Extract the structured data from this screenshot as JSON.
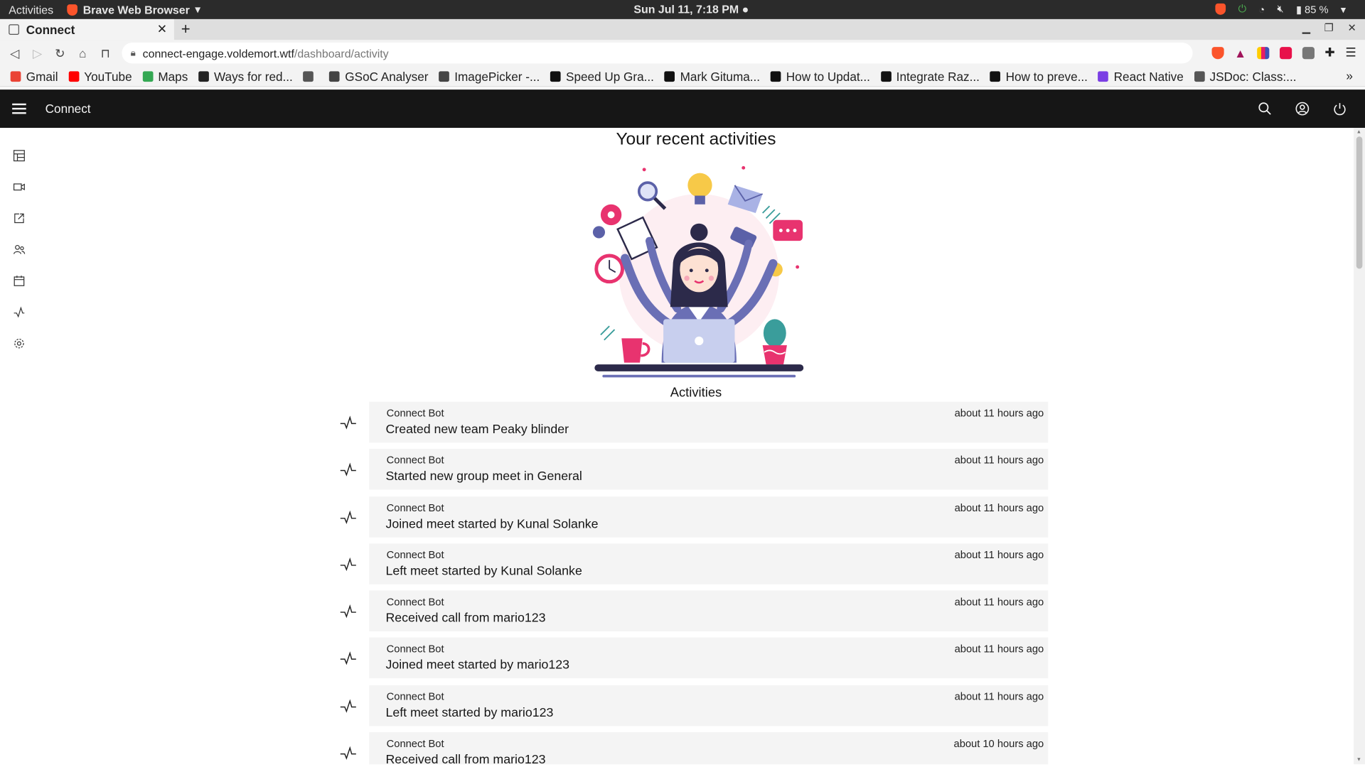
{
  "os": {
    "activities": "Activities",
    "app_name": "Brave Web Browser",
    "clock": "Sun Jul 11,  7:18 PM",
    "battery": "85 %"
  },
  "browser": {
    "tab_title": "Connect",
    "url_host": "connect-engage.voldemort.wtf",
    "url_path": "/dashboard/activity",
    "bookmarks": [
      {
        "label": "Gmail",
        "color": "#ea4335"
      },
      {
        "label": "YouTube",
        "color": "#ff0000"
      },
      {
        "label": "Maps",
        "color": "#34a853"
      },
      {
        "label": "Ways for red...",
        "color": "#222222"
      },
      {
        "label": "",
        "color": "#555555"
      },
      {
        "label": "GSoC Analyser",
        "color": "#444444"
      },
      {
        "label": "ImagePicker -...",
        "color": "#444444"
      },
      {
        "label": "Speed Up Gra...",
        "color": "#111111"
      },
      {
        "label": "Mark Gituma...",
        "color": "#111111"
      },
      {
        "label": "How to Updat...",
        "color": "#111111"
      },
      {
        "label": "Integrate Raz...",
        "color": "#111111"
      },
      {
        "label": "How to preve...",
        "color": "#111111"
      },
      {
        "label": "React Native",
        "color": "#7b3fe4"
      },
      {
        "label": "JSDoc: Class:...",
        "color": "#555555"
      }
    ]
  },
  "app": {
    "title": "Connect",
    "page_heading": "Your recent activities",
    "activities_heading": "Activities",
    "activities": [
      {
        "author": "Connect Bot",
        "message": "Created new team Peaky blinder",
        "time": "about 11 hours ago"
      },
      {
        "author": "Connect Bot",
        "message": "Started new group meet in General",
        "time": "about 11 hours ago"
      },
      {
        "author": "Connect Bot",
        "message": "Joined meet started by Kunal Solanke",
        "time": "about 11 hours ago"
      },
      {
        "author": "Connect Bot",
        "message": "Left meet started by Kunal Solanke",
        "time": "about 11 hours ago"
      },
      {
        "author": "Connect Bot",
        "message": "Received call from mario123",
        "time": "about 11 hours ago"
      },
      {
        "author": "Connect Bot",
        "message": "Joined meet started by mario123",
        "time": "about 11 hours ago"
      },
      {
        "author": "Connect Bot",
        "message": "Left meet started by mario123",
        "time": "about 11 hours ago"
      },
      {
        "author": "Connect Bot",
        "message": "Received call from mario123",
        "time": "about 10 hours ago"
      }
    ]
  },
  "colors": {
    "header_bg": "#161616",
    "card_bg": "#f4f4f4",
    "accent_pink": "#e8336f",
    "accent_purple": "#6a6fb5"
  }
}
